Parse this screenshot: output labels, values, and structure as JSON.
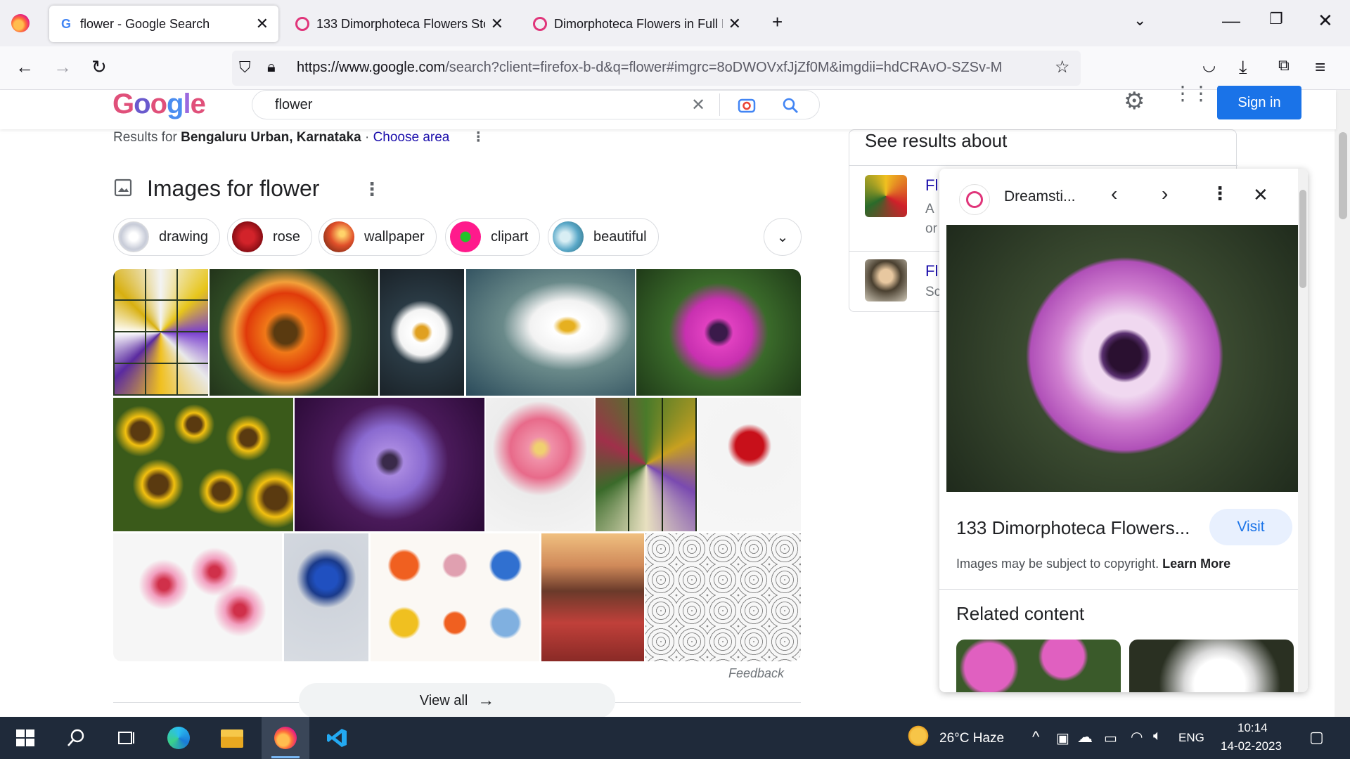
{
  "browser": {
    "tabs": [
      {
        "title": "flower - Google Search",
        "active": true
      },
      {
        "title": "133 Dimorphoteca Flowers Stoc",
        "active": false
      },
      {
        "title": "Dimorphoteca Flowers in Full Bl",
        "active": false
      }
    ],
    "url_host": "https://www.google.com",
    "url_rest": "/search?client=firefox-b-d&q=flower#imgrc=8oDWOVxfJjZf0M&imgdii=hdCRAvO-SZSv-M",
    "new_tab_symbol": "+"
  },
  "google": {
    "logo": "Google",
    "query": "flower",
    "sign_in": "Sign in",
    "results_for_prefix": "Results for",
    "location": "Bengaluru Urban, Karnataka",
    "separator": "·",
    "choose_area": "Choose area",
    "images_title": "Images for flower",
    "chips": [
      "drawing",
      "rose",
      "wallpaper",
      "clipart",
      "beautiful"
    ],
    "feedback": "Feedback",
    "view_all": "View all",
    "see_results_about": "See results about",
    "about_items": [
      {
        "title": "Fl",
        "line1": "A",
        "line2": "or"
      },
      {
        "title": "Fl",
        "line1": "Sc"
      }
    ]
  },
  "preview": {
    "source": "Dreamsti...",
    "title": "133 Dimorphoteca Flowers...",
    "visit": "Visit",
    "copyright": "Images may be subject to copyright.",
    "learn_more": "Learn More",
    "related": "Related content"
  },
  "taskbar": {
    "weather": "26°C  Haze",
    "lang": "ENG",
    "time": "10:14",
    "date": "14-02-2023"
  },
  "colors": {
    "accent": "#1a73e8",
    "taskbar": "#1f2a3a",
    "link": "#1a0dab"
  }
}
